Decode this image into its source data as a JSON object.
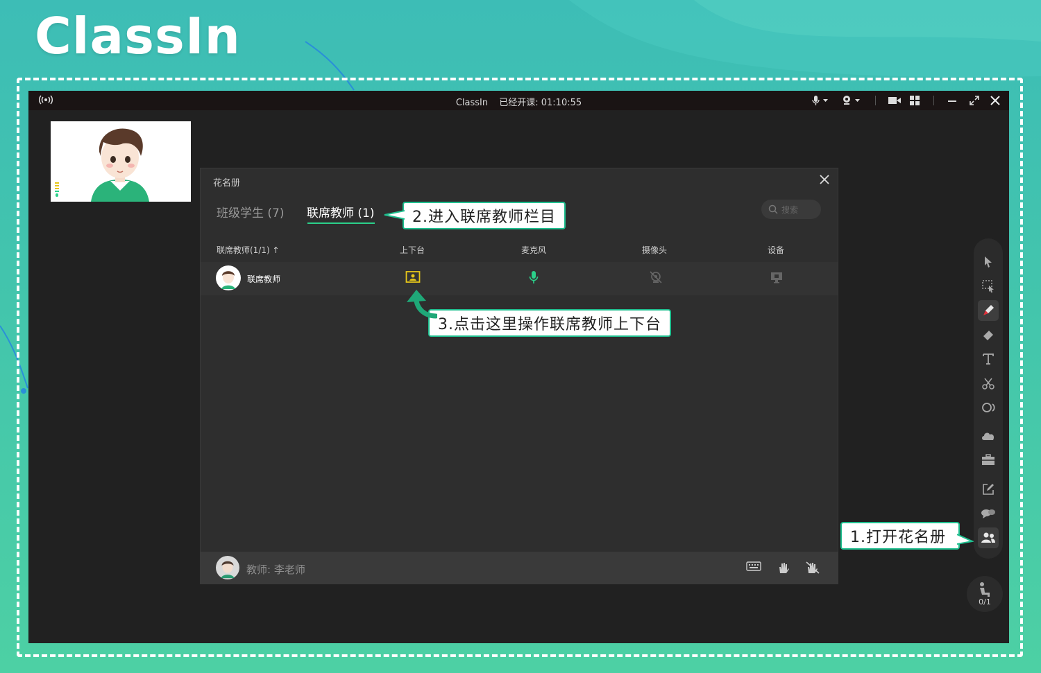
{
  "brand": {
    "logo_text": "ClassIn"
  },
  "window": {
    "app_name": "ClassIn",
    "class_status": "已经开课: 01:10:55"
  },
  "roster": {
    "title": "花名册",
    "tabs": [
      {
        "label": "班级学生 (7)"
      },
      {
        "label": "联席教师 (1)"
      }
    ],
    "search_placeholder": "搜索",
    "columns": [
      "联席教师(1/1) ↑",
      "上下台",
      "麦克风",
      "摄像头",
      "设备"
    ],
    "rows": [
      {
        "name": "联席教师"
      }
    ],
    "footer_teacher": "教师: 李老师"
  },
  "seat_counter": "0/1",
  "callouts": {
    "step1": "1.打开花名册",
    "step2": "2.进入联席教师栏目",
    "step3": "3.点击这里操作联席教师上下台"
  },
  "colors": {
    "accent_green": "#2bd08a",
    "stage_yellow": "#e6c619",
    "callout_border": "#1fbf8f"
  }
}
